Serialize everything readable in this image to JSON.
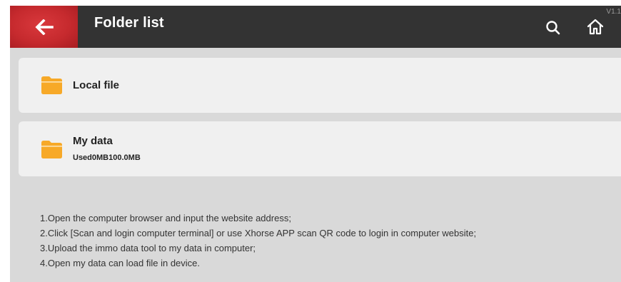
{
  "header": {
    "title": "Folder list",
    "version": "V1.1",
    "back_icon": "arrow-left-icon",
    "search_icon": "search-icon",
    "home_icon": "home-icon"
  },
  "folders": [
    {
      "label": "Local file",
      "sub": "",
      "icon": "folder-icon"
    },
    {
      "label": "My data",
      "sub": "Used0MB100.0MB",
      "icon": "folder-icon"
    }
  ],
  "instructions": [
    "1.Open the computer browser and input the website address;",
    "2.Click [Scan and login computer terminal] or use Xhorse APP scan QR code to login in computer website;",
    "3.Upload the immo data tool to my data in computer;",
    "4.Open my data can load file in device."
  ],
  "colors": {
    "accent_red": "#c62a2e",
    "header_bg": "#333333",
    "folder": "#f7a928",
    "background": "#d9d9d9",
    "card": "#f0f0f0"
  }
}
